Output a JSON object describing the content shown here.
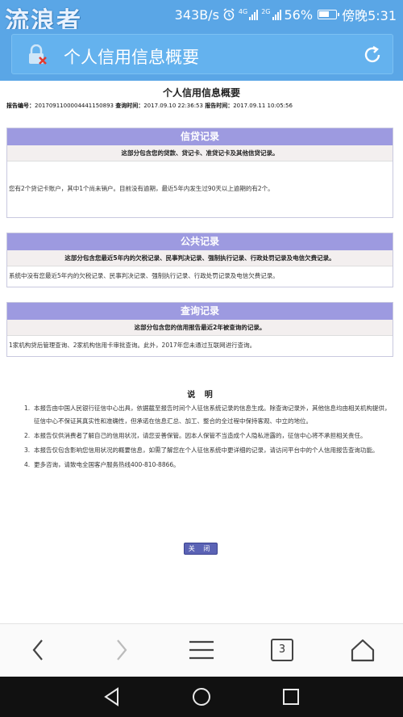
{
  "status_bar": {
    "watermark": "流浪者",
    "speed": "343B/s",
    "network_1": "4G",
    "network_2": "2G",
    "battery": "56%",
    "time": "傍晚5:31"
  },
  "header": {
    "title": "个人信用信息概要"
  },
  "report": {
    "title": "个人信用信息概要",
    "number_label": "报告编号：",
    "number": "2017091100004441150893",
    "query_time_label": "查询时间：",
    "query_time": "2017.09.10 22:36:53",
    "report_time_label": "报告时间：",
    "report_time": "2017.09.11 10:05:56"
  },
  "sections": {
    "credit": {
      "title": "信贷记录",
      "subtitle": "这部分包含您的贷款、贷记卡、准贷记卡及其他信贷记录。",
      "body": "您有2个贷记卡账户，其中1个尚未销户。目前没有逾期，最近5年内发生过90天以上逾期的有2个。"
    },
    "public": {
      "title": "公共记录",
      "subtitle": "这部分包含您最近5年内的欠税记录、民事判决记录、强制执行记录、行政处罚记录及电信欠费记录。",
      "body": "系统中没有您最近5年内的欠税记录、民事判决记录、强制执行记录、行政处罚记录及电信欠费记录。"
    },
    "query": {
      "title": "查询记录",
      "subtitle": "这部分包含您的信用报告最近2年被查询的记录。",
      "body": "1家机构贷后管理查询、2家机构信用卡审批查询。此外，2017年您未通过互联网进行查询。"
    }
  },
  "notes": {
    "title": "说 明",
    "items": [
      {
        "num": "1.",
        "text": "本报告由中国人民银行征信中心出具，依据截至报告时间个人征信系统记录的信息生成。除查询记录外，其他信息均由相关机构提供，征信中心不保证其真实性和准确性，但承诺在信息汇总、加工、整合的全过程中保持客观、中立的地位。"
      },
      {
        "num": "2.",
        "text": "本报告仅供消费者了解自己的信用状况，请您妥善保管。因本人保管不当造成个人隐私泄露的，征信中心将不承担相关责任。"
      },
      {
        "num": "3.",
        "text": "本报告仅包含影响您信用状况的概要信息，如需了解您在个人征信系统中更详细的记录，请访问平台中的个人信用报告查询功能。"
      },
      {
        "num": "4.",
        "text": "更多咨询，请致电全国客户服务热线400-810-8866。"
      }
    ]
  },
  "close_button": "关 闭",
  "browser": {
    "tab_count": "3"
  },
  "colors": {
    "accent_blue": "#5aa6e6",
    "section_header": "#9d9ae0",
    "button": "#5b63b5"
  }
}
